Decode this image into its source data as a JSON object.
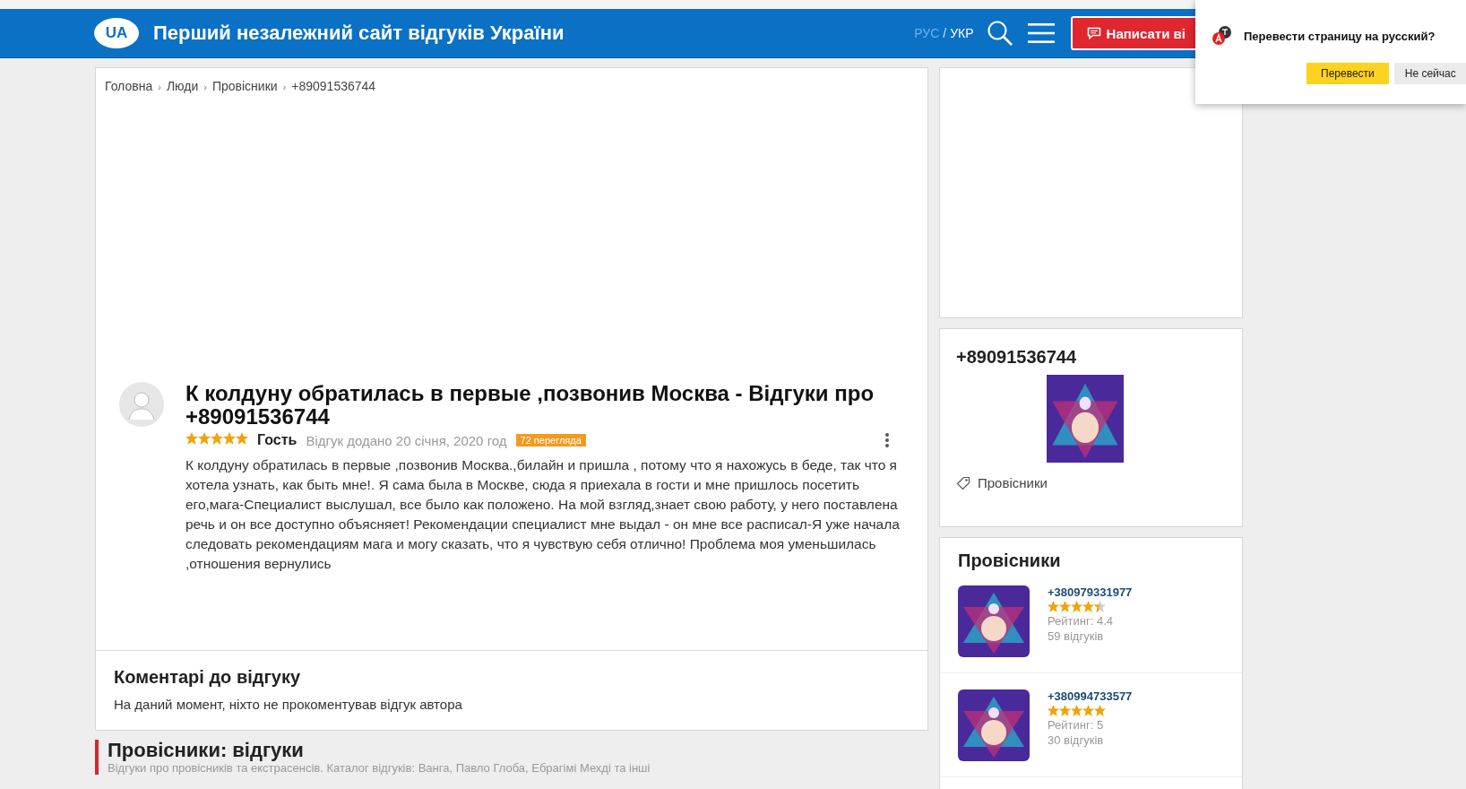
{
  "header": {
    "logo": "UA",
    "title": "Перший незалежний сайт відгуків України",
    "languages": [
      {
        "label": "РУС",
        "selected": false
      },
      {
        "label": "УКР",
        "selected": true
      }
    ],
    "language_separator": "/",
    "write_button": "Написати ві"
  },
  "translate_popup": {
    "message": "Перевести страницу на русский?",
    "buttons": [
      "Перевести",
      "Не сейчас"
    ]
  },
  "breadcrumbs": [
    {
      "label": "Головна",
      "separator": "›"
    },
    {
      "label": "Люди",
      "separator": "›"
    },
    {
      "label": "Провісники",
      "separator": "›"
    },
    {
      "label": "+89091536744"
    }
  ],
  "review": {
    "title": "К колдуну обратилась в первые ,позвонив Москва - Відгуки про +89091536744",
    "stars": 5,
    "author": "Гость",
    "date": "Відгук додано 20 січня, 2020 год",
    "views": "72 перегляда",
    "text": "К колдуну обратилась в первые ,позвонив Москва.,билайн и пришла , потому что я нахожусь в беде, так что я хотела узнать, как быть мне!. Я сама была в Москве, сюда я приехала в гости и мне пришлось посетить его,мага-Специалист выслушал, все было как положено. На мой взгляд,знает свою работу, у него поставлена речь и он все доступно объясняет! Рекомендации специалист мне выдал - он мне все расписал-Я уже начала следовать рекомендациям мага и могу сказать, что я чувствую себя отлично! Проблема моя уменьшилась ,отношения вернулись"
  },
  "comments": {
    "title": "Коментарі до відгуку",
    "empty_text": "На даний момент, ніхто не прокоментував відгук автора"
  },
  "category": {
    "title": "Провісники: відгуки",
    "subtitle": "Відгуки про провісників та екстрасенсів. Каталог відгуків: Ванга, Павло Глоба, Ебрагімі Мехді та інші"
  },
  "sidebar": {
    "profile": {
      "name": "+89091536744",
      "tag": "Провісники"
    },
    "related": {
      "title": "Провісники",
      "items": [
        {
          "name": "+380979331977",
          "stars": 4.4,
          "rating": "Рейтинг: 4.4",
          "reviews": "59 відгуків"
        },
        {
          "name": "+380994733577",
          "stars": 5,
          "rating": "Рейтинг: 5",
          "reviews": "30 відгуків"
        }
      ]
    }
  }
}
